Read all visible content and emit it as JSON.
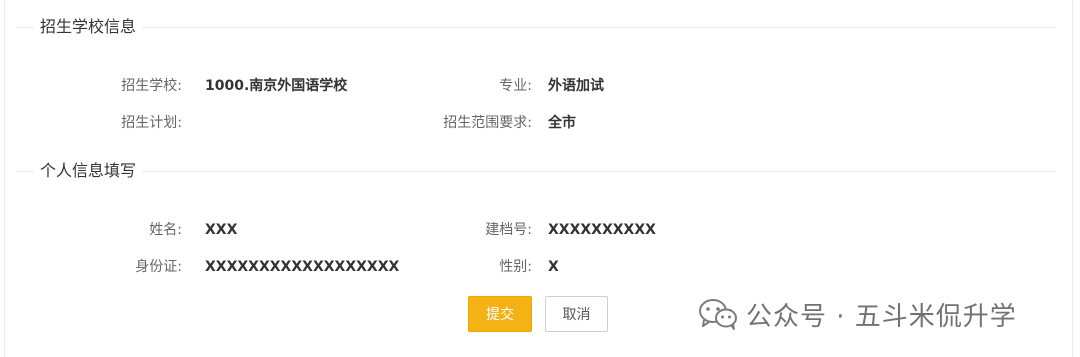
{
  "school_section": {
    "title": "招生学校信息",
    "school_label": "招生学校:",
    "school_value": "1000.南京外国语学校",
    "major_label": "专业:",
    "major_value": "外语加试",
    "plan_label": "招生计划:",
    "plan_value": "",
    "scope_label": "招生范围要求:",
    "scope_value": "全市"
  },
  "personal_section": {
    "title": "个人信息填写",
    "name_label": "姓名:",
    "name_value": "XXX",
    "file_label": "建档号:",
    "file_value": "XXXXXXXXXX",
    "id_label": "身份证:",
    "id_value": "XXXXXXXXXXXXXXXXXX",
    "gender_label": "性别:",
    "gender_value": "X"
  },
  "actions": {
    "submit_label": "提交",
    "cancel_label": "取消",
    "submit_color": "#f5b215"
  },
  "watermark": {
    "text": "公众号 · 五斗米侃升学",
    "icon": "wechat-icon"
  }
}
